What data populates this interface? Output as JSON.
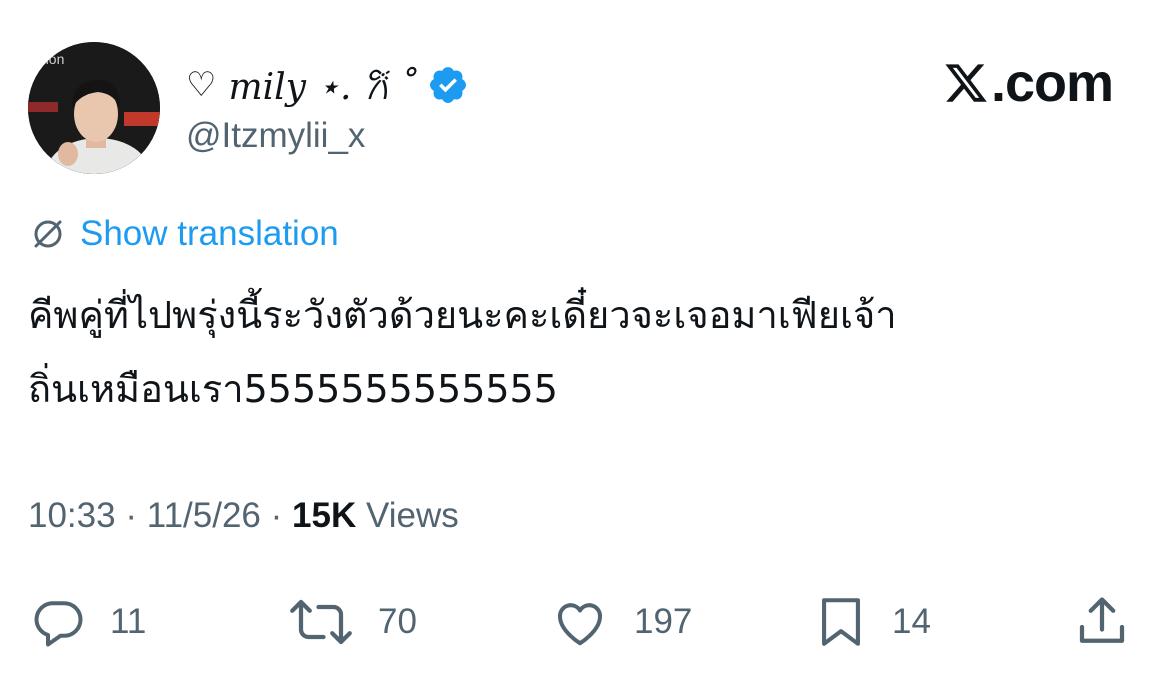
{
  "tweet": {
    "display_name": "mily ⋆. 𐙚 ˚",
    "handle": "@Itzmylii_x",
    "show_translation": "Show translation",
    "text_line1": "คีพคู่ที่ไปพรุ่งนี้ระวังตัวด้วยนะคะเดี๋ยวจะเจอมาเฟียเจ้า",
    "text_line2": "ถิ่นเหมือนเรา5555555555555",
    "time": "10:33",
    "date": "11/5/26",
    "views_count": "15K",
    "views_label": "Views"
  },
  "brand": {
    "site": ".com"
  },
  "stats": {
    "replies": "11",
    "reposts": "70",
    "likes": "197",
    "bookmarks": "14"
  },
  "icons": {
    "heart": "heart-icon",
    "verified": "verified-badge-icon",
    "translate": "globe-icon",
    "reply": "reply-icon",
    "repost": "repost-icon",
    "like": "like-icon",
    "bookmark": "bookmark-icon",
    "share": "share-icon"
  },
  "colors": {
    "accent": "#1d9bf0",
    "muted": "#536471",
    "text": "#0f1419"
  }
}
